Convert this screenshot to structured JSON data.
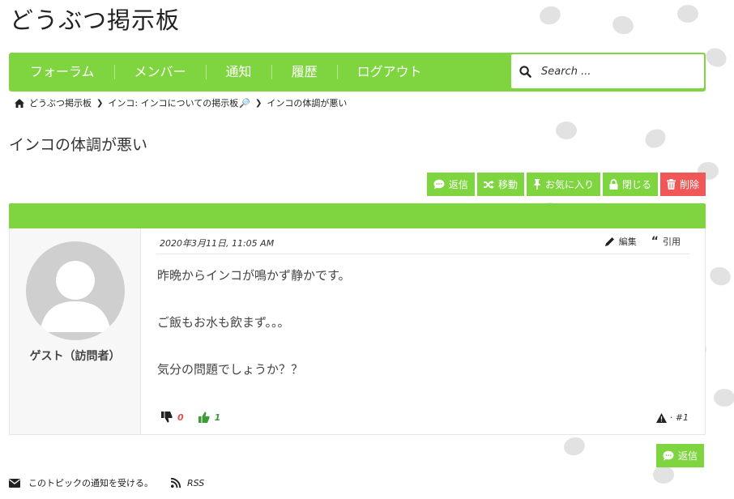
{
  "site": {
    "title": "どうぶつ掲示板"
  },
  "nav": {
    "items": [
      "フォーラム",
      "メンバー",
      "通知",
      "履歴",
      "ログアウト"
    ],
    "search_placeholder": "Search ..."
  },
  "breadcrumb": {
    "home": "どうぶつ掲示板",
    "forum": "インコ: インコについての掲示板",
    "current": "インコの体調が悪い"
  },
  "topic": {
    "title": "インコの体調が悪い"
  },
  "actions": {
    "reply": "返信",
    "move": "移動",
    "favorite": "お気に入り",
    "close": "閉じる",
    "delete": "削除"
  },
  "post": {
    "date": "2020年3月11日, 11:05 AM",
    "edit": "編集",
    "quote": "引用",
    "author": "ゲスト（訪問者）",
    "lines": [
      "昨晩からインコが鳴かず静かです。",
      "ご飯もお水も飲まず。。。",
      "気分の問題でしょうか？？"
    ],
    "downvotes": "0",
    "upvotes": "1",
    "post_number": "· #1"
  },
  "bottom_reply": "返信",
  "footer": {
    "subscribe": "このトピックの通知を受ける。",
    "rss": "RSS"
  },
  "colors": {
    "accent": "#7fd53f",
    "danger": "#f05858"
  },
  "icons": [
    "home-icon",
    "search-icon",
    "chat-icon",
    "shuffle-icon",
    "pin-icon",
    "lock-icon",
    "trash-icon",
    "pencil-icon",
    "quote-icon",
    "thumbs-down-icon",
    "thumbs-up-icon",
    "warning-icon",
    "envelope-icon",
    "rss-icon"
  ]
}
